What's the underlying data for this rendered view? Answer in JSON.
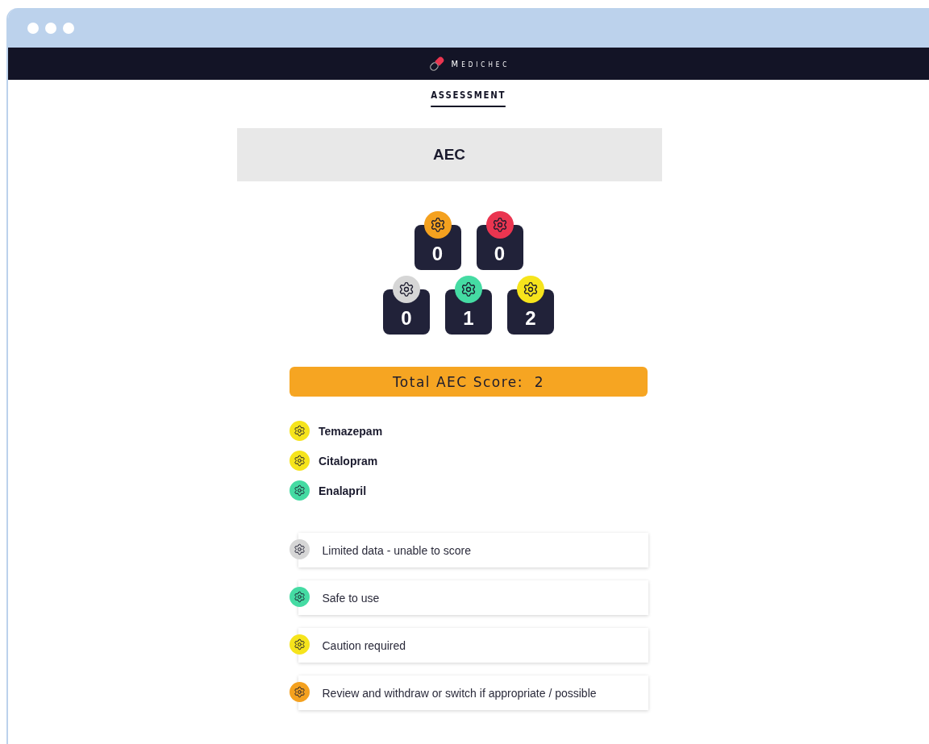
{
  "brand": {
    "name": "MEDICHEC"
  },
  "tab": {
    "label": "ASSESSMENT",
    "selected": true
  },
  "heading": "AEC",
  "score_tiles": [
    {
      "value": "0",
      "color": "#f4a11f"
    },
    {
      "value": "0",
      "color": "#ea3550"
    },
    {
      "value": "0",
      "color": "#d6d6d6"
    },
    {
      "value": "1",
      "color": "#45dba3"
    },
    {
      "value": "2",
      "color": "#f6e41c"
    }
  ],
  "total": {
    "label": "Total AEC Score:",
    "value": "2"
  },
  "medications": [
    {
      "name": "Temazepam",
      "color": "#f6e41c"
    },
    {
      "name": "Citalopram",
      "color": "#f6e41c"
    },
    {
      "name": "Enalapril",
      "color": "#45dba3"
    }
  ],
  "legend": [
    {
      "label": "Limited data - unable to score",
      "color": "#d6d6d6"
    },
    {
      "label": "Safe to use",
      "color": "#45dba3"
    },
    {
      "label": "Caution required",
      "color": "#f6e41c"
    },
    {
      "label": "Review and withdraw or switch if appropriate / possible",
      "color": "#f4a11f"
    }
  ]
}
